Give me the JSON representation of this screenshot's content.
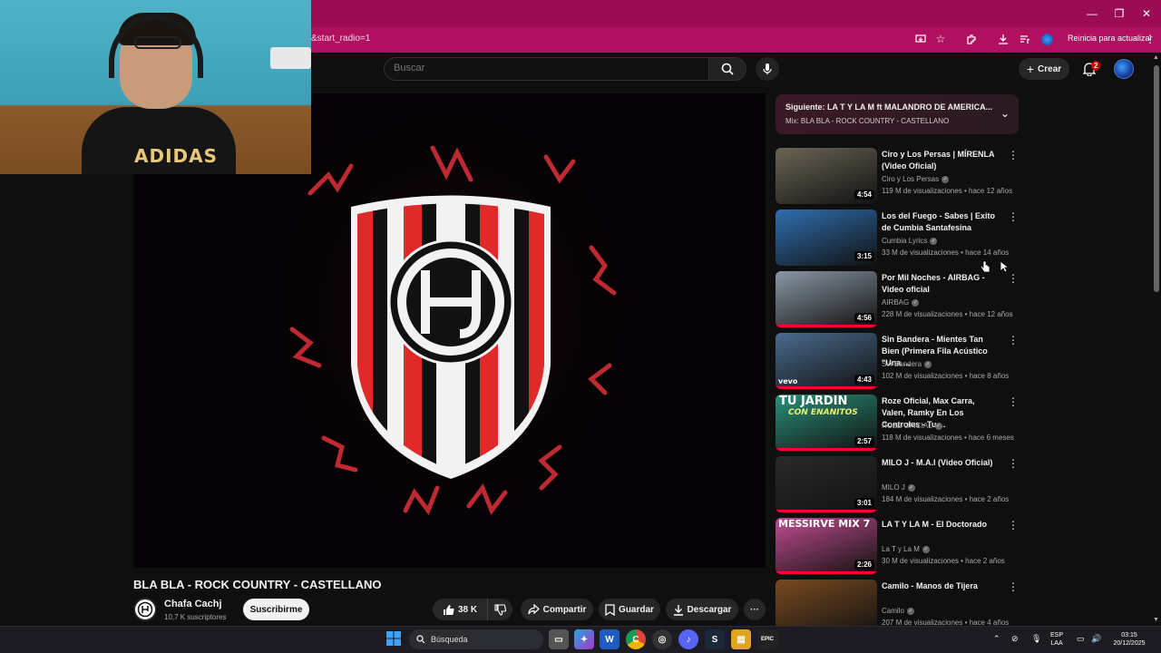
{
  "browser": {
    "url_fragment": "&start_radio=1",
    "update_label": "Reinicia para actualizar",
    "window_controls": [
      "—",
      "❐",
      "✕"
    ]
  },
  "header": {
    "search_placeholder": "Buscar",
    "create_label": "Crear",
    "notifications_count": "2"
  },
  "video": {
    "title": "BLA BLA - ROCK COUNTRY - CASTELLANO",
    "channel": "Chafa Cachj",
    "subscribers": "10,7 K suscriptores",
    "subscribe_label": "Suscribirme",
    "likes": "38 K",
    "share_label": "Compartir",
    "save_label": "Guardar",
    "download_label": "Descargar",
    "more_label": "···"
  },
  "webcam": {
    "shirt_text": "ADIDAS"
  },
  "playlist": {
    "next_title": "Siguiente: LA T Y LA M ft MALANDRO DE AMERICA...",
    "mix_label": "Mix: BLA BLA - ROCK COUNTRY - CASTELLANO",
    "items": [
      {
        "title": "Ciro y Los Persas | MÍRENLA (Video Oficial)",
        "channel": "Ciro y Los Persas",
        "meta": "119 M de visualizaciones • hace 12 años",
        "duration": "4:54",
        "thumb": "#6b6555",
        "progress": 0
      },
      {
        "title": "Los del Fuego - Sabes | Exito de Cumbia Santafesina",
        "channel": "Cumbia Lyrics",
        "meta": "33 M de visualizaciones • hace 14 años",
        "duration": "3:15",
        "thumb": "#2f6fb0",
        "progress": 0
      },
      {
        "title": "Por Mil Noches - AIRBAG - Video oficial",
        "channel": "AIRBAG",
        "meta": "228 M de visualizaciones • hace 12 años",
        "duration": "4:56",
        "thumb": "#8a98a6",
        "progress": 1
      },
      {
        "title": "Sin Bandera - Mientes Tan Bien (Primera Fila Acústico \"Una ...",
        "channel": "Sin Bandera",
        "meta": "102 M de visualizaciones • hace 8 años",
        "duration": "4:43",
        "thumb": "#4a6b8f",
        "progress": 1
      },
      {
        "title": "Roze Oficial, Max Carra, Valen, Ramky En Los Controles - Tu ...",
        "channel": "ROZE OFICIAL",
        "meta": "118 M de visualizaciones • hace 6 meses",
        "duration": "2:57",
        "thumb": "#2b8f7a",
        "progress": 1
      },
      {
        "title": "MILO J - M.A.I (Video Oficial)",
        "channel": "MILO J",
        "meta": "184 M de visualizaciones • hace 2 años",
        "duration": "3:01",
        "thumb": "#2a2a2a",
        "progress": 1
      },
      {
        "title": "LA T Y LA M - El Doctorado",
        "channel": "La T y La M",
        "meta": "30 M de visualizaciones • hace 2 años",
        "duration": "2:26",
        "thumb": "#c04d90",
        "progress": 1
      },
      {
        "title": "Camilo - Manos de Tijera",
        "channel": "Camilo",
        "meta": "207 M de visualizaciones • hace 4 años",
        "duration": "",
        "thumb": "#7a4a20",
        "progress": 0
      }
    ]
  },
  "thumb_labels": {
    "tu_jardin": "TU JARDIN",
    "con_enanitos": "CON ENANITOS",
    "messirve": "MESSIRVE MIX 7",
    "vevo": "vevo"
  },
  "taskbar": {
    "search_label": "Búsqueda",
    "language": "ESP",
    "region": "LAA",
    "time": "03:15",
    "date": "20/12/2025",
    "apps": [
      "W",
      "C",
      "◎",
      "♪",
      "S",
      "▤",
      "EPIC"
    ]
  },
  "colors": {
    "brand_red": "#ff0033",
    "chrome_pink": "#b0105f",
    "titlebar": "#9a0d54"
  }
}
